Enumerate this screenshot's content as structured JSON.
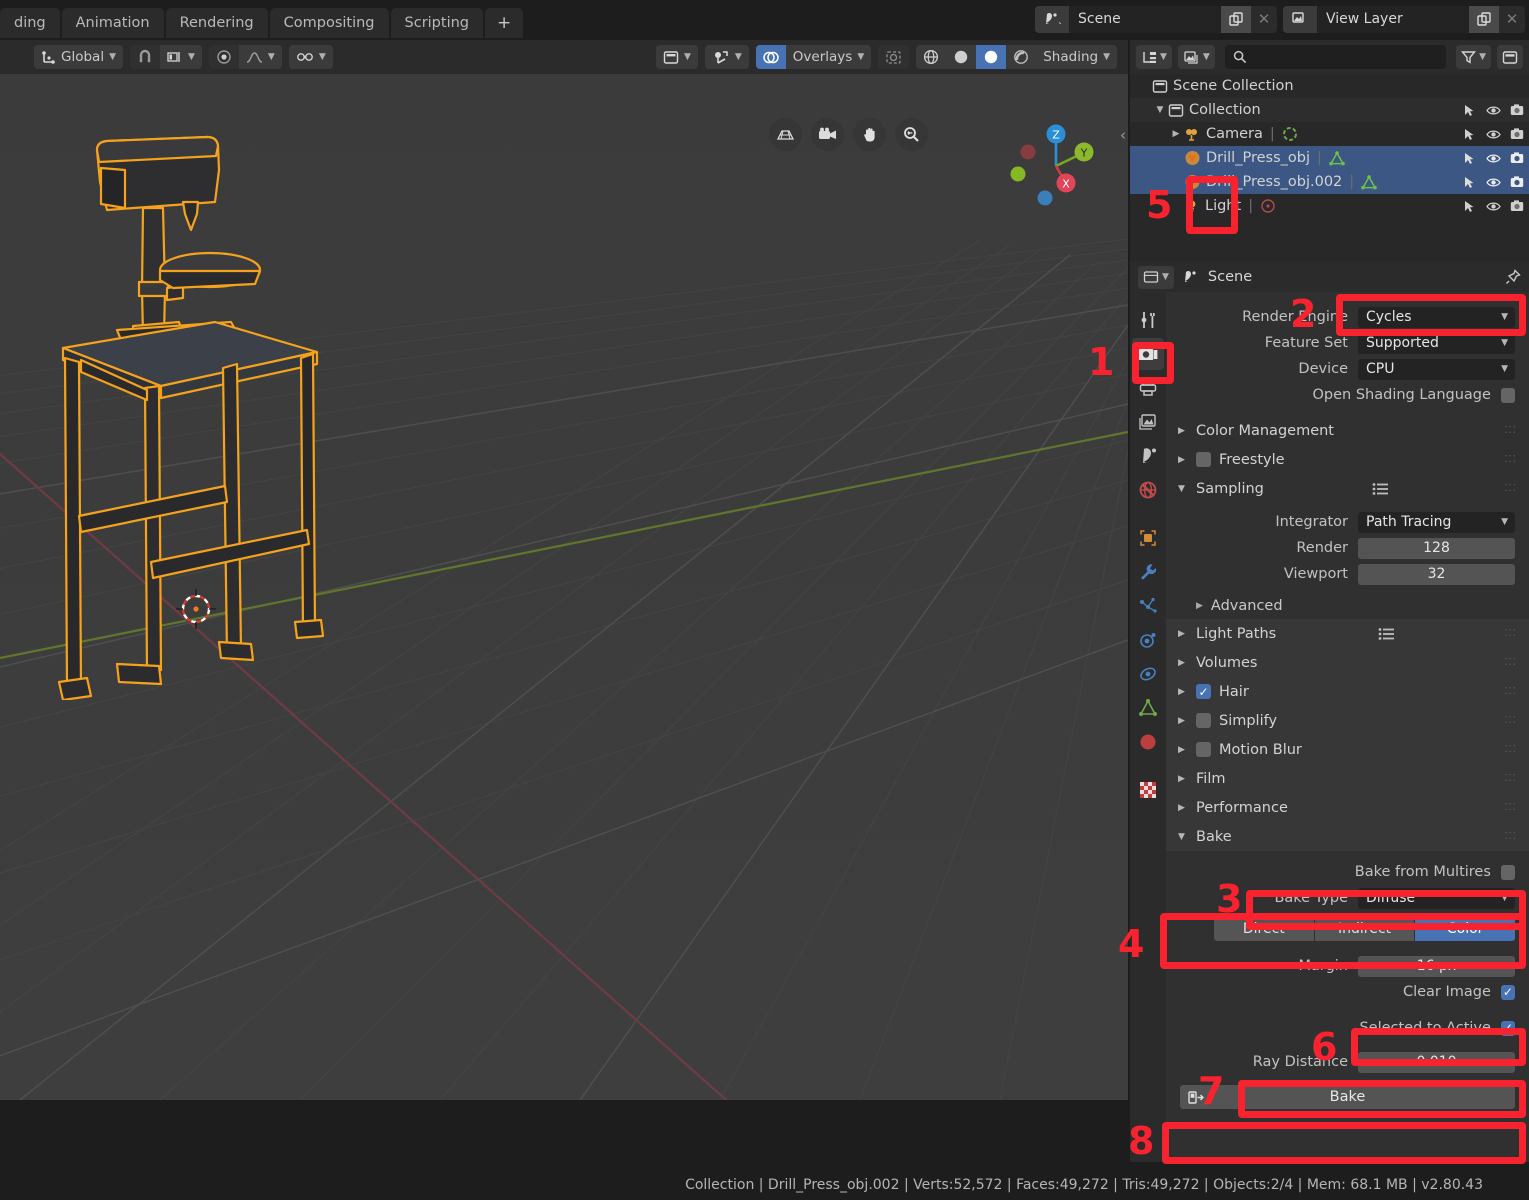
{
  "topbar": {
    "tabs": [
      {
        "label": "ding"
      },
      {
        "label": "Animation"
      },
      {
        "label": "Rendering"
      },
      {
        "label": "Compositing"
      },
      {
        "label": "Scripting"
      },
      {
        "label": "+"
      }
    ],
    "scene": {
      "name": "Scene",
      "icon": "scene-icon",
      "copy_icon": "new-scene-icon",
      "close_icon": "x-icon"
    },
    "view_layer": {
      "name": "View Layer",
      "icon": "view-layer-icon",
      "copy_icon": "new-layer-icon",
      "close_icon": "x-icon"
    }
  },
  "viewport": {
    "header": {
      "transform_orientation": "Global",
      "snap_icon": "magnet-icon",
      "snap_mode_icon": "snap-increment-icon",
      "pivot_icon": "pivot-point-icon",
      "proportional_icon": "proportional-falloff-icon",
      "proportional_edit_icon": "proportional-edit-icon",
      "view_object_icon": "editor-type-icon",
      "gizmo_icon": "gizmo-icon",
      "overlays_label": "Overlays",
      "xray_icon": "xray-icon",
      "shading_label": "Shading",
      "shade_wireframe_icon": "wireframe-icon",
      "shade_solid_icon": "solid-icon",
      "shade_material_icon": "material-preview-icon",
      "shade_rendered_icon": "rendered-icon"
    },
    "nav_buttons": [
      "toggle-ortho-icon",
      "camera-view-icon",
      "pan-view-icon",
      "zoom-view-icon"
    ],
    "gizmo_axes": [
      "Z",
      "Y",
      "X"
    ],
    "collapse_arrow": "‹"
  },
  "outliner": {
    "header": {
      "display_mode_icon": "outliner-display-mode-icon",
      "filter_id_icon": "id-type-filter-icon",
      "search_placeholder": "",
      "search_icon": "search-icon",
      "filter_icon": "funnel-icon",
      "new_collection_icon": "new-collection-icon"
    },
    "rows": [
      {
        "label": "Scene Collection",
        "icon": "scene-collection-icon",
        "indent": 0,
        "selected": false,
        "disclosure": "",
        "show_cols": false,
        "data_icon": ""
      },
      {
        "label": "Collection",
        "icon": "collection-icon",
        "indent": 1,
        "selected": false,
        "disclosure": "▼",
        "show_cols": true,
        "data_icon": ""
      },
      {
        "label": "Camera",
        "icon": "camera-object-icon",
        "indent": 2,
        "selected": false,
        "disclosure": "▶",
        "show_cols": true,
        "data_icon": "camera-data-icon"
      },
      {
        "label": "Drill_Press_obj",
        "icon": "mesh-object-icon",
        "indent": 2,
        "selected": true,
        "disclosure": "",
        "show_cols": true,
        "data_icon": "mesh-data-icon"
      },
      {
        "label": "Drill_Press_obj.002",
        "icon": "mesh-object-icon",
        "indent": 2,
        "selected": true,
        "disclosure": "",
        "show_cols": true,
        "data_icon": "mesh-data-icon"
      },
      {
        "label": "Light",
        "icon": "light-object-icon",
        "indent": 2,
        "selected": false,
        "disclosure": "",
        "show_cols": true,
        "data_icon": "light-data-icon"
      }
    ],
    "column_icons": [
      "select-arrow-icon",
      "eye-icon",
      "camera-render-icon"
    ]
  },
  "properties": {
    "header": {
      "editor_icon": "properties-editor-icon",
      "title": "Scene",
      "pin_icon": "pin-icon"
    },
    "tabs": [
      {
        "name": "tool-tab",
        "icon": "tool-icon",
        "active": false
      },
      {
        "name": "render-tab",
        "icon": "render-camera-icon",
        "active": true
      },
      {
        "name": "output-tab",
        "icon": "printer-icon",
        "active": false
      },
      {
        "name": "view-layer-tab",
        "icon": "images-icon",
        "active": false
      },
      {
        "name": "scene-tab",
        "icon": "scene-cone-icon",
        "active": false
      },
      {
        "name": "world-tab",
        "icon": "world-globe-icon",
        "active": false
      },
      {
        "name": "object-tab",
        "icon": "object-square-icon",
        "active": false
      },
      {
        "name": "modifier-tab",
        "icon": "wrench-icon",
        "active": false
      },
      {
        "name": "particles-tab",
        "icon": "particles-icon",
        "active": false
      },
      {
        "name": "physics-tab",
        "icon": "physics-orbit-icon",
        "active": false
      },
      {
        "name": "constraints-tab",
        "icon": "constraint-icon",
        "active": false
      },
      {
        "name": "data-tab",
        "icon": "mesh-data-triangle-icon",
        "active": false
      },
      {
        "name": "material-tab",
        "icon": "material-sphere-icon",
        "active": false
      },
      {
        "name": "texture-tab",
        "icon": "texture-checker-icon",
        "active": false
      }
    ],
    "render_engine": {
      "label": "Render Engine",
      "value": "Cycles"
    },
    "feature_set": {
      "label": "Feature Set",
      "value": "Supported"
    },
    "device": {
      "label": "Device",
      "value": "CPU"
    },
    "osl": {
      "label": "Open Shading Language",
      "checked": false
    },
    "color_management": {
      "label": "Color Management"
    },
    "freestyle": {
      "label": "Freestyle",
      "checked": false
    },
    "sampling": {
      "label": "Sampling",
      "integrator": {
        "label": "Integrator",
        "value": "Path Tracing"
      },
      "render": {
        "label": "Render",
        "value": "128"
      },
      "viewport": {
        "label": "Viewport",
        "value": "32"
      },
      "advanced": {
        "label": "Advanced"
      }
    },
    "light_paths": {
      "label": "Light Paths"
    },
    "volumes": {
      "label": "Volumes"
    },
    "hair": {
      "label": "Hair",
      "checked": true
    },
    "simplify": {
      "label": "Simplify",
      "checked": false
    },
    "motion_blur": {
      "label": "Motion Blur",
      "checked": false
    },
    "film": {
      "label": "Film"
    },
    "performance": {
      "label": "Performance"
    },
    "bake": {
      "label": "Bake",
      "from_multires": {
        "label": "Bake from Multires",
        "checked": false
      },
      "bake_type": {
        "label": "Bake Type",
        "value": "Diffuse"
      },
      "contributions": [
        {
          "label": "Direct",
          "active": false
        },
        {
          "label": "Indirect",
          "active": false
        },
        {
          "label": "Color",
          "active": true
        }
      ],
      "margin": {
        "label": "Margin",
        "value": "16 px"
      },
      "clear_image": {
        "label": "Clear Image",
        "checked": true
      },
      "selected_to_active": {
        "label": "Selected to Active",
        "checked": true
      },
      "ray_distance": {
        "label": "Ray Distance",
        "value": "0.010"
      },
      "bake_button": {
        "label": "Bake",
        "icon": "bake-render-icon"
      }
    }
  },
  "statusbar": {
    "text": "Collection | Drill_Press_obj.002 | Verts:52,572 | Faces:49,272 | Tris:49,272 | Objects:2/4 | Mem: 68.1 MB | v2.80.43"
  },
  "annotations": {
    "color": "#f8232f",
    "steps": [
      {
        "num": "1",
        "target": "render-properties-tab"
      },
      {
        "num": "2",
        "target": "render-engine-dropdown"
      },
      {
        "num": "3",
        "target": "bake-type-row"
      },
      {
        "num": "4",
        "target": "bake-contributions-row"
      },
      {
        "num": "5",
        "target": "outliner-mesh-object-icons"
      },
      {
        "num": "6",
        "target": "selected-to-active-row"
      },
      {
        "num": "7",
        "target": "ray-distance-row"
      },
      {
        "num": "8",
        "target": "bake-button"
      }
    ]
  }
}
